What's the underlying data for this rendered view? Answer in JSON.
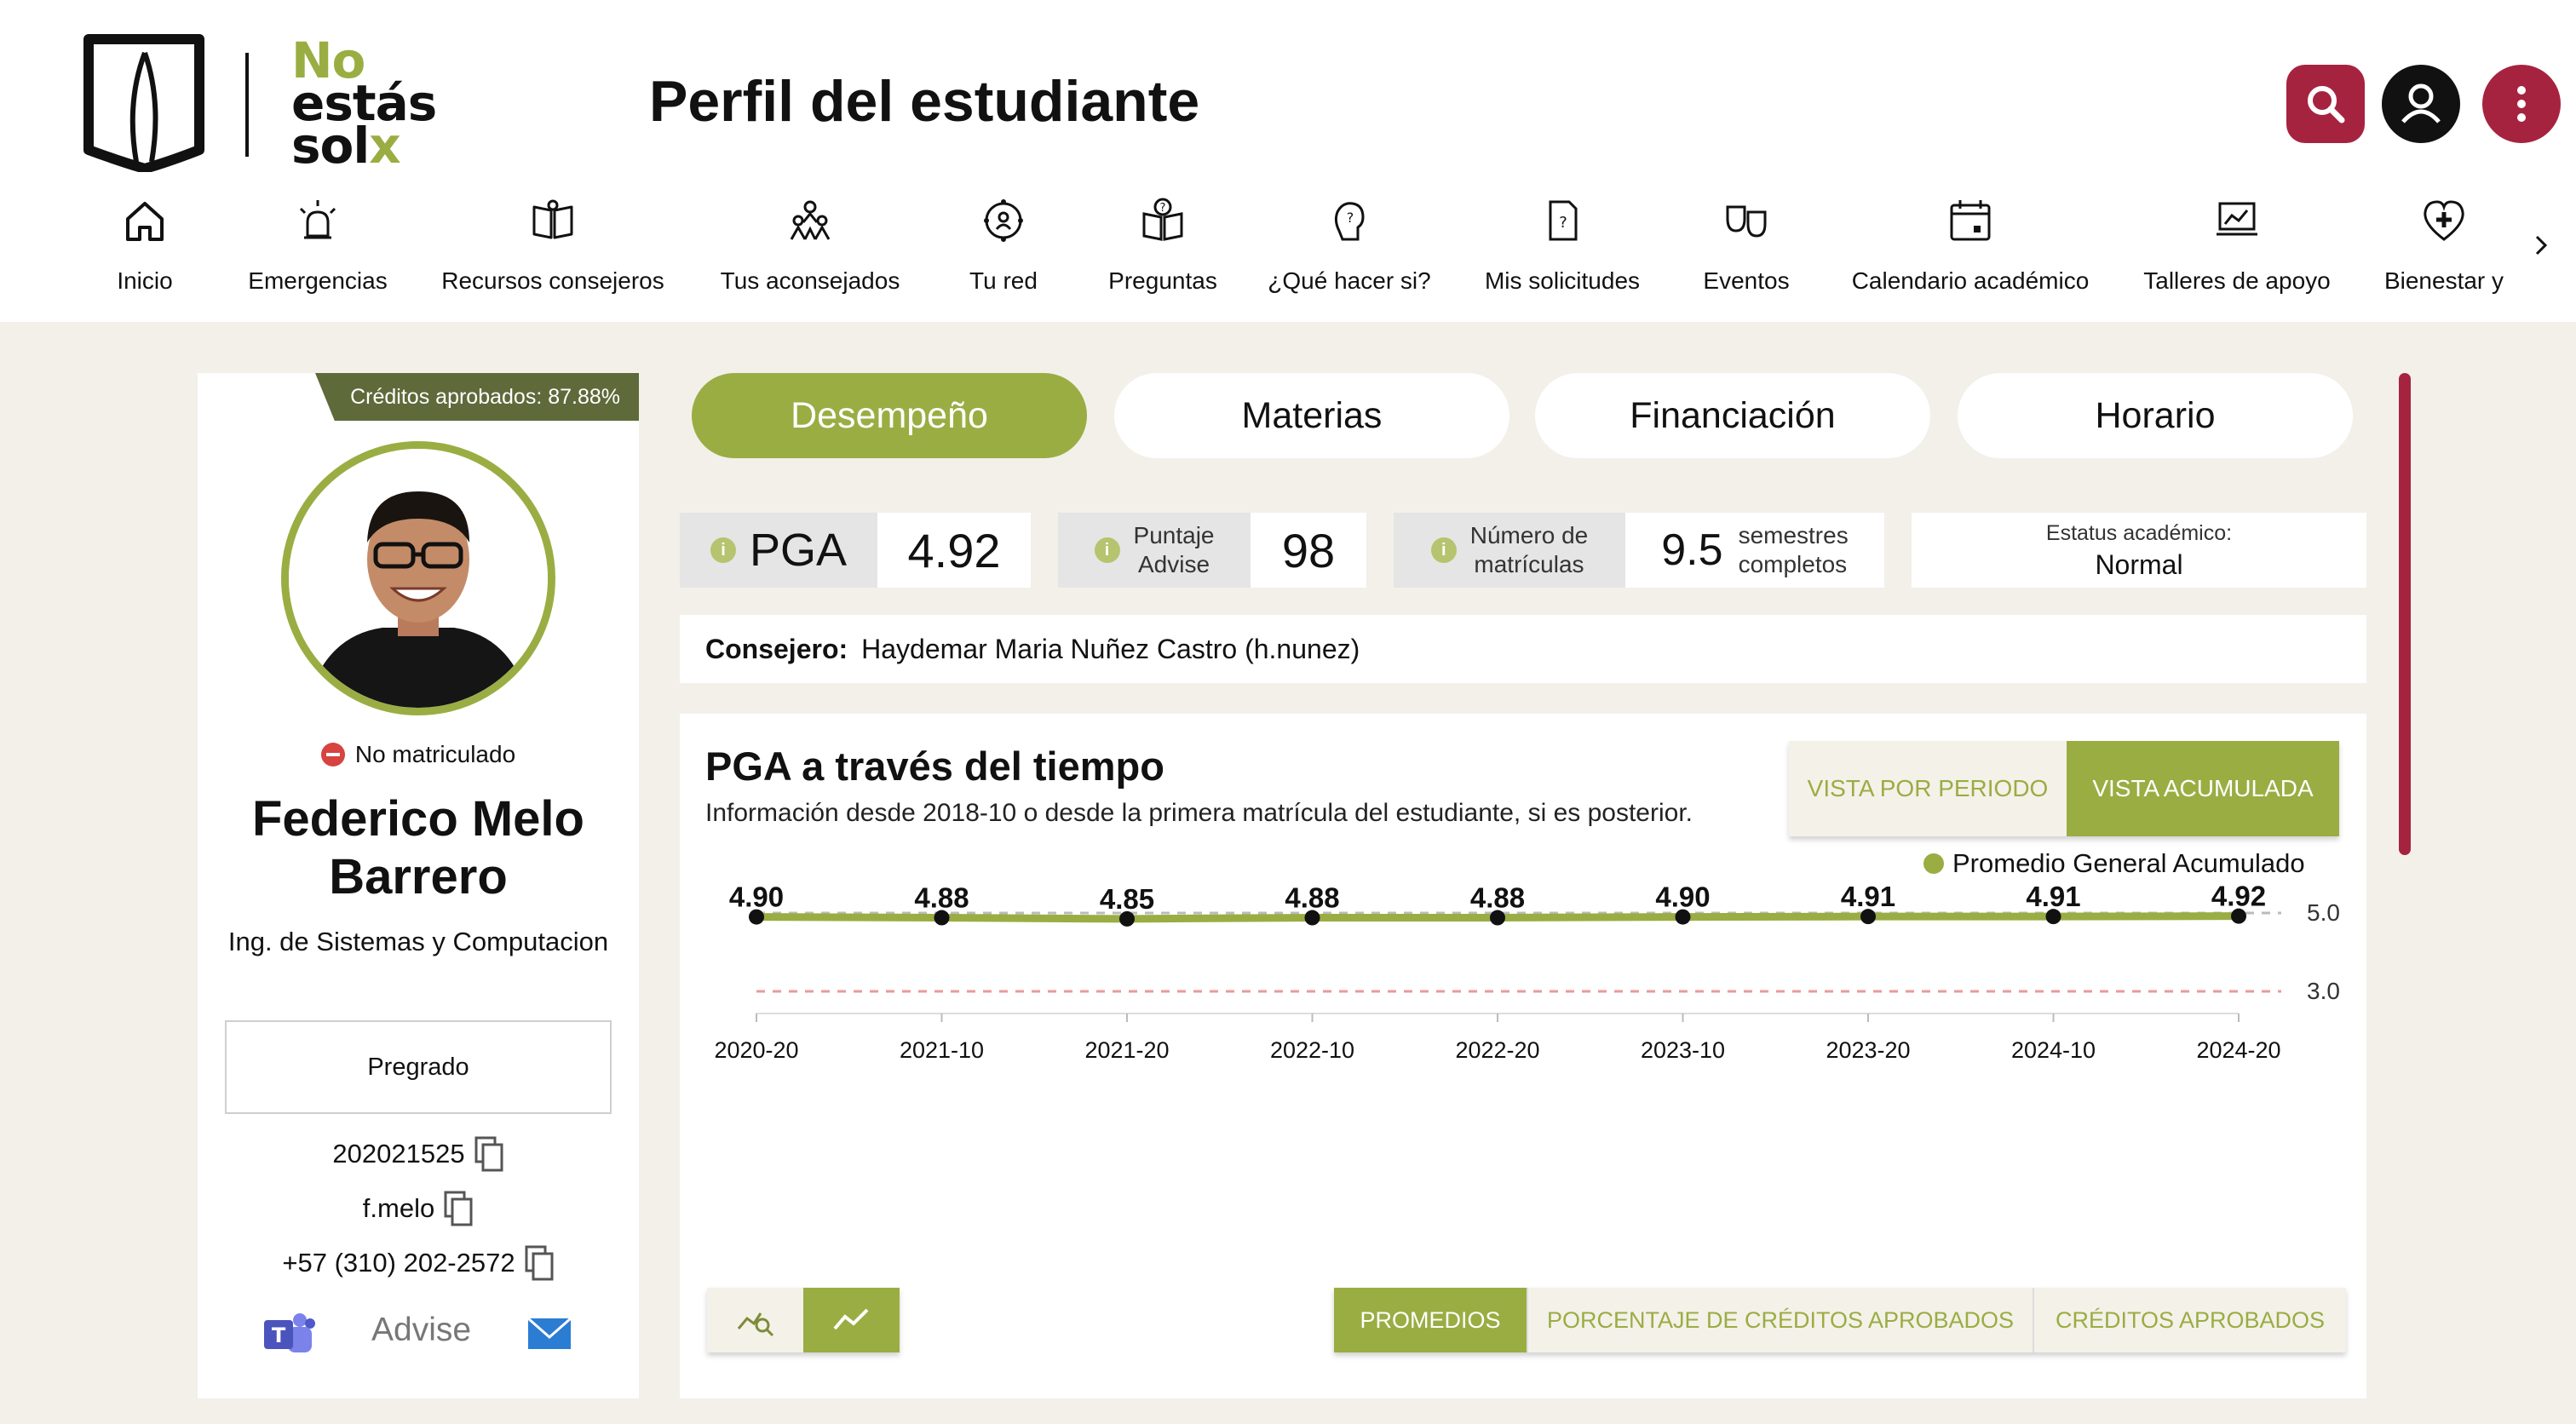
{
  "header": {
    "logo": {
      "line1": "No",
      "line2": "estás",
      "line3_a": "sol",
      "line3_b": "x"
    },
    "title": "Perfil del estudiante",
    "actions": [
      "search-icon",
      "user-icon",
      "more-vertical-icon"
    ],
    "accent": "#a6233f"
  },
  "nav": {
    "items": [
      {
        "label": "Inicio",
        "icon": "home-icon"
      },
      {
        "label": "Emergencias",
        "icon": "alarm-icon"
      },
      {
        "label": "Recursos consejeros",
        "icon": "book-icon"
      },
      {
        "label": "Tus aconsejados",
        "icon": "people-icon"
      },
      {
        "label": "Tu red",
        "icon": "network-icon"
      },
      {
        "label": "Preguntas",
        "icon": "question-book-icon"
      },
      {
        "label": "¿Qué hacer si?",
        "icon": "help-head-icon"
      },
      {
        "label": "Mis solicitudes",
        "icon": "request-icon"
      },
      {
        "label": "Eventos",
        "icon": "theater-icon"
      },
      {
        "label": "Calendario académico",
        "icon": "calendar-icon"
      },
      {
        "label": "Talleres de apoyo",
        "icon": "workshop-icon"
      },
      {
        "label": "Bienestar y",
        "icon": "heart-plus-icon"
      }
    ]
  },
  "profile": {
    "credits_badge": "Créditos aprobados: 87.88%",
    "status": "No matriculado",
    "name": "Federico Melo Barrero",
    "program": "Ing. de Sistemas y Computacion",
    "level": "Pregrado",
    "student_id": "202021525",
    "username": "f.melo",
    "phone": "+57 (310) 202-2572",
    "advise_label": "Advise"
  },
  "tabs": [
    "Desempeño",
    "Materias",
    "Financiación",
    "Horario"
  ],
  "stats": {
    "pga": {
      "label": "PGA",
      "value": "4.92"
    },
    "advise": {
      "label_1": "Puntaje",
      "label_2": "Advise",
      "value": "98"
    },
    "enrollments": {
      "label_1": "Número de",
      "label_2": "matrículas",
      "value": "9.5",
      "unit_1": "semestres",
      "unit_2": "completos"
    },
    "estatus": {
      "label": "Estatus académico:",
      "value": "Normal"
    }
  },
  "advisor": {
    "label": "Consejero:",
    "value": "Haydemar Maria Nuñez Castro (h.nunez)"
  },
  "chart": {
    "title": "PGA a través del tiempo",
    "subtitle": "Información desde 2018-10 o desde la primera matrícula del estudiante, si es posterior.",
    "view_period": "VISTA POR PERIODO",
    "view_accum": "VISTA ACUMULADA",
    "legend": "Promedio General Acumulado",
    "metrics": [
      "PROMEDIOS",
      "PORCENTAJE DE CRÉDITOS APROBADOS",
      "CRÉDITOS APROBADOS"
    ]
  },
  "chart_data": {
    "type": "line",
    "x": [
      "2020-20",
      "2021-10",
      "2021-20",
      "2022-10",
      "2022-20",
      "2023-10",
      "2023-20",
      "2024-10",
      "2024-20"
    ],
    "series": [
      {
        "name": "Promedio General Acumulado",
        "values": [
          4.9,
          4.88,
          4.85,
          4.88,
          4.88,
          4.9,
          4.91,
          4.91,
          4.92
        ],
        "color": "#9aad43"
      }
    ],
    "data_labels": [
      "4.90",
      "4.88",
      "4.85",
      "4.88",
      "4.88",
      "4.90",
      "4.91",
      "4.91",
      "4.92"
    ],
    "reference_lines": [
      {
        "label": "5.0",
        "value": 5.0,
        "color": "#bbbbbb"
      },
      {
        "label": "3.0",
        "value": 3.0,
        "color": "#e99a9a"
      }
    ],
    "legend_position": "top-right"
  }
}
